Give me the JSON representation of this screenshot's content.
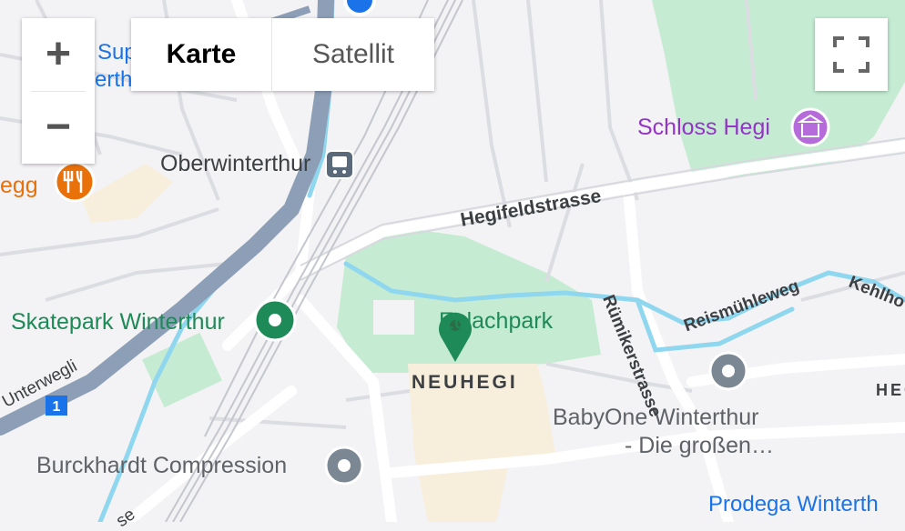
{
  "controls": {
    "zoom_in": "+",
    "zoom_out": "−",
    "map_type": {
      "map": "Karte",
      "satellite": "Satellit",
      "selected": "Karte"
    },
    "fullscreen_icon": "fullscreen-icon"
  },
  "labels": {
    "oberwinterthur": "Oberwinterthur",
    "schloss_hegi": "Schloss Hegi",
    "skatepark": "Skatepark Winterthur",
    "burckhardt": "Burckhardt Compression",
    "babyone_line1": "BabyOne Winterthur",
    "babyone_line2": "- Die großen…",
    "prodega": "Prodega Winterth",
    "hegifeldstrasse": "Hegifeldstrasse",
    "rumikerstrasse": "Rümikerstrasse",
    "reismuhleweg": "Reismühleweg",
    "kehlhof": "Kehlho",
    "unterwegli": "Unterwegli",
    "neuhegi": "NEUHEGI",
    "eulachpark": "Eulachpark",
    "sup_partial": "Sup",
    "erth_partial": "erth",
    "egg_partial": "egg",
    "heg_partial": "HEG",
    "se_partial": "se",
    "route_shield": "1"
  },
  "colors": {
    "background": "#f3f2f4",
    "park": "#c5ecd3",
    "water": "#8fd6ef",
    "highway": "#8c9fb7",
    "road": "#ffffff",
    "builtup": "#f7efdc",
    "marker_green": "#1e8a57",
    "poi_purple": "#9334c6",
    "poi_orange": "#e8710a",
    "poi_grey": "#7b8792"
  }
}
